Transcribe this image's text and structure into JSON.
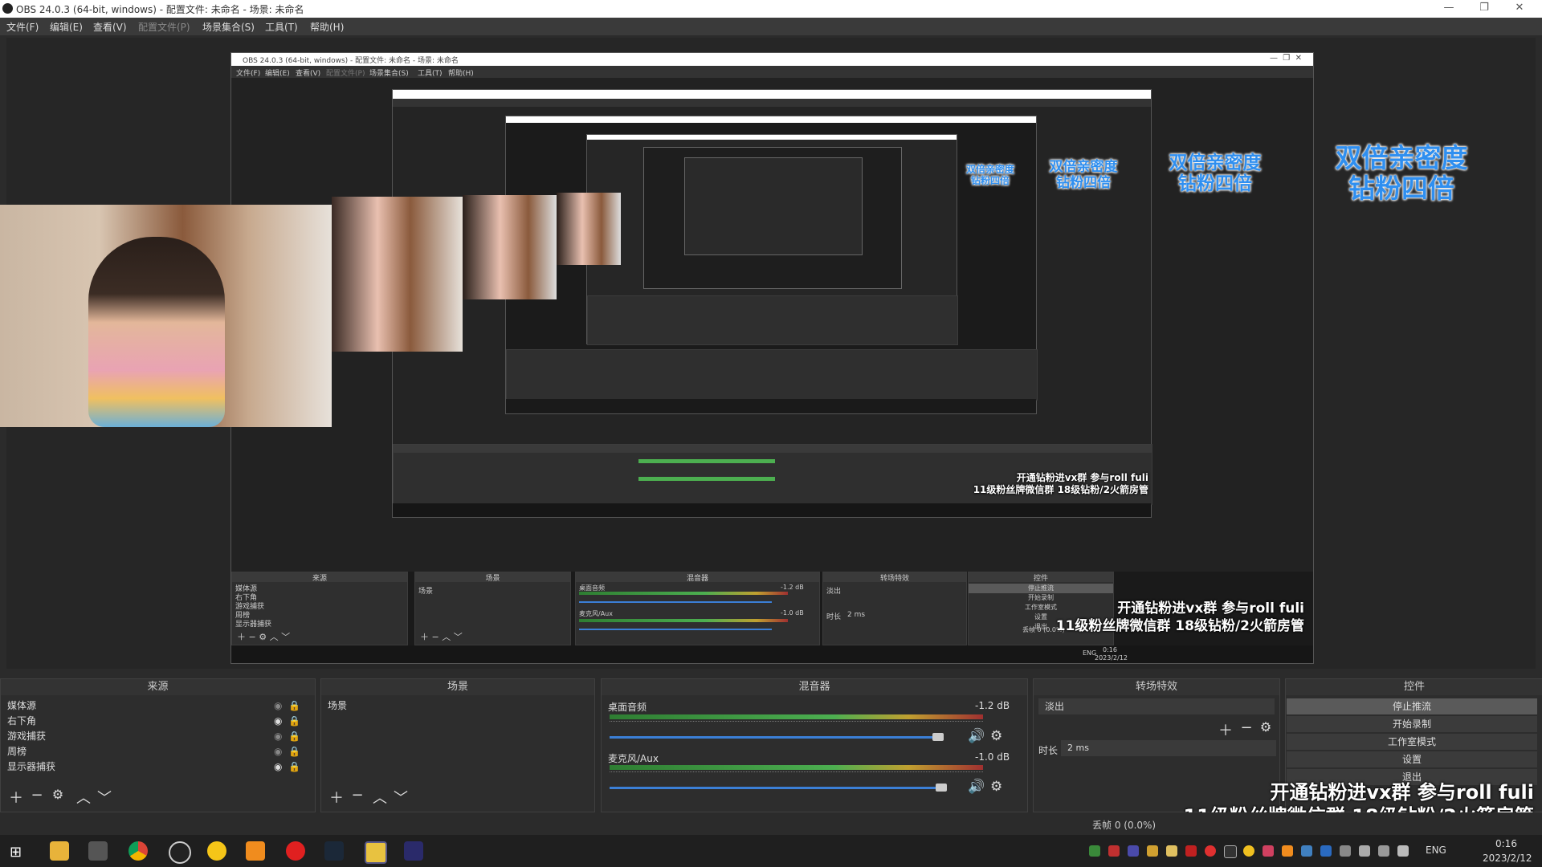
{
  "window": {
    "title": "OBS 24.0.3 (64-bit, windows) - 配置文件: 未命名 - 场景: 未命名"
  },
  "menu": [
    "文件(F)",
    "编辑(E)",
    "查看(V)",
    "配置文件(P)",
    "场景集合(S)",
    "工具(T)",
    "帮助(H)"
  ],
  "nested": {
    "title": "OBS 24.0.3 (64-bit, windows) - 配置文件: 未命名 - 场景: 未命名",
    "menu": [
      "文件(F)",
      "编辑(E)",
      "查看(V)",
      "配置文件(P)",
      "场景集合(S)",
      "工具(T)",
      "帮助(H)"
    ],
    "sources_title": "来源",
    "scenes_title": "场景",
    "mixer_title": "混音器",
    "transitions_title": "转场特效",
    "controls_title": "控件",
    "sources": [
      "媒体源",
      "右下角",
      "游戏捕获",
      "周榜",
      "显示器捕获"
    ],
    "scene": "场景",
    "audio1": "桌面音频",
    "audio1_db": "-1.2 dB",
    "audio2": "麦克风/Aux",
    "audio2_db": "-1.0 dB",
    "transition": "淡出",
    "duration_label": "时长",
    "duration": "2 ms",
    "controls": [
      "停止推流",
      "开始录制",
      "工作室模式",
      "设置",
      "退出"
    ],
    "dropped": "丢帧 0 (0.0%)",
    "clock_time": "0:16",
    "clock_date": "2023/2/12",
    "lang": "ENG"
  },
  "promo": {
    "line1": "双倍亲密度",
    "line2": "钻粉四倍"
  },
  "stream_text": {
    "line1": "开通钻粉进vx群 参与roll fuli",
    "line2": "11级粉丝牌微信群 18级钻粉/2火箭房管"
  },
  "docks": {
    "sources_title": "来源",
    "scenes_title": "场景",
    "mixer_title": "混音器",
    "transitions_title": "转场特效",
    "controls_title": "控件"
  },
  "sources": [
    {
      "name": "媒体源",
      "visible": false,
      "locked": true
    },
    {
      "name": "右下角",
      "visible": true,
      "locked": true
    },
    {
      "name": "游戏捕获",
      "visible": false,
      "locked": true
    },
    {
      "name": "周榜",
      "visible": false,
      "locked": true
    },
    {
      "name": "显示器捕获",
      "visible": true,
      "locked": true
    }
  ],
  "scenes": [
    "场景"
  ],
  "mixer": {
    "track1": {
      "name": "桌面音频",
      "db": "-1.2 dB",
      "volume": 0.9
    },
    "track2": {
      "name": "麦克风/Aux",
      "db": "-1.0 dB",
      "volume": 0.91
    }
  },
  "transitions": {
    "selected": "淡出",
    "duration_label": "时长",
    "duration": "2 ms"
  },
  "controls": [
    "停止推流",
    "开始录制",
    "工作室模式",
    "设置",
    "退出"
  ],
  "status": {
    "dropped": "丢帧 0 (0.0%)"
  },
  "taskbar": {
    "lang": "ENG",
    "time": "0:16",
    "date": "2023/2/12"
  },
  "icons": {
    "minimize": "minimize-icon",
    "maximize": "maximize-icon",
    "close": "close-icon"
  }
}
